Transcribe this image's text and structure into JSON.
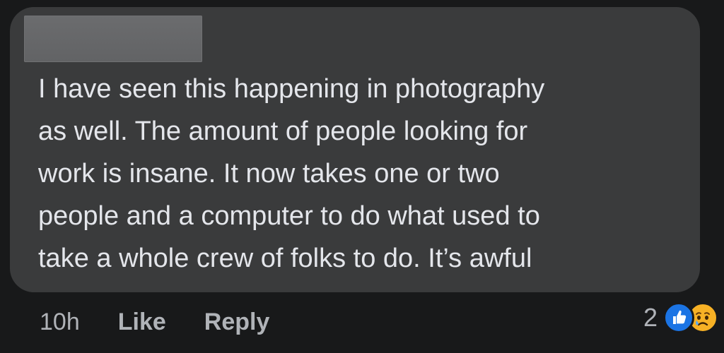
{
  "comment": {
    "text": "I have seen this happening in photography\nas well. The amount of people looking for\nwork is insane. It now takes one or two\npeople and a computer to do what used to\ntake a whole crew of folks to do. It’s awful"
  },
  "actions": {
    "timestamp": "10h",
    "like_label": "Like",
    "reply_label": "Reply"
  },
  "reactions": {
    "count": "2",
    "icons": [
      "like-icon",
      "sad-face-icon"
    ]
  },
  "colors": {
    "background": "#18191a",
    "bubble": "#3a3b3c",
    "text": "#e4e6eb",
    "secondary_text": "#b0b3b8",
    "like_blue": "#1b74e4",
    "sad_yellow": "#f7b125"
  }
}
